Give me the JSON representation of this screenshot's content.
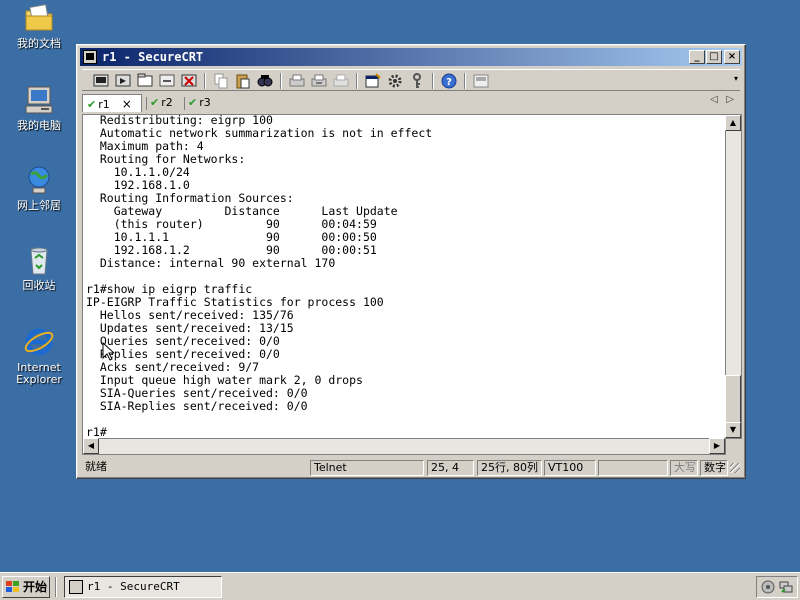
{
  "desktop": {
    "icons": [
      {
        "label": "我的文档",
        "icon": "my-documents-icon"
      },
      {
        "label": "我的电脑",
        "icon": "my-computer-icon"
      },
      {
        "label": "网上邻居",
        "icon": "network-places-icon"
      },
      {
        "label": "回收站",
        "icon": "recycle-bin-icon"
      },
      {
        "label_line1": "Internet",
        "label_line2": "Explorer",
        "icon": "internet-explorer-icon"
      }
    ]
  },
  "window": {
    "title": "r1 - SecureCRT",
    "title_color": "#0a246a",
    "controls": {
      "minimize": "_",
      "maximize": "□",
      "close": "×"
    }
  },
  "tabs": {
    "items": [
      {
        "label": "r1",
        "check": "✔",
        "close": "×"
      },
      {
        "label": "r2",
        "check": "✔"
      },
      {
        "label": "r3",
        "check": "✔"
      }
    ],
    "nav_prev": "◁",
    "nav_next": "▷"
  },
  "terminal": {
    "text": "  Redistributing: eigrp 100\n  Automatic network summarization is not in effect\n  Maximum path: 4\n  Routing for Networks:\n    10.1.1.0/24\n    192.168.1.0\n  Routing Information Sources:\n    Gateway         Distance      Last Update\n    (this router)         90      00:04:59\n    10.1.1.1              90      00:00:50\n    192.168.1.2           90      00:00:51\n  Distance: internal 90 external 170\n\nr1#show ip eigrp traffic\nIP-EIGRP Traffic Statistics for process 100\n  Hellos sent/received: 135/76\n  Updates sent/received: 13/15\n  Queries sent/received: 0/0\n  Replies sent/received: 0/0\n  Acks sent/received: 9/7\n  Input queue high water mark 2, 0 drops\n  SIA-Queries sent/received: 0/0\n  SIA-Replies sent/received: 0/0\n\nr1#"
  },
  "statusbar": {
    "ready": "就绪",
    "protocol": "Telnet",
    "cursor_pos": "25,  4",
    "size": "25行, 80列",
    "emulation": "VT100",
    "caps": "大写",
    "num": "数字"
  },
  "taskbar": {
    "start_label": "开始",
    "task_label": "r1 - SecureCRT"
  }
}
